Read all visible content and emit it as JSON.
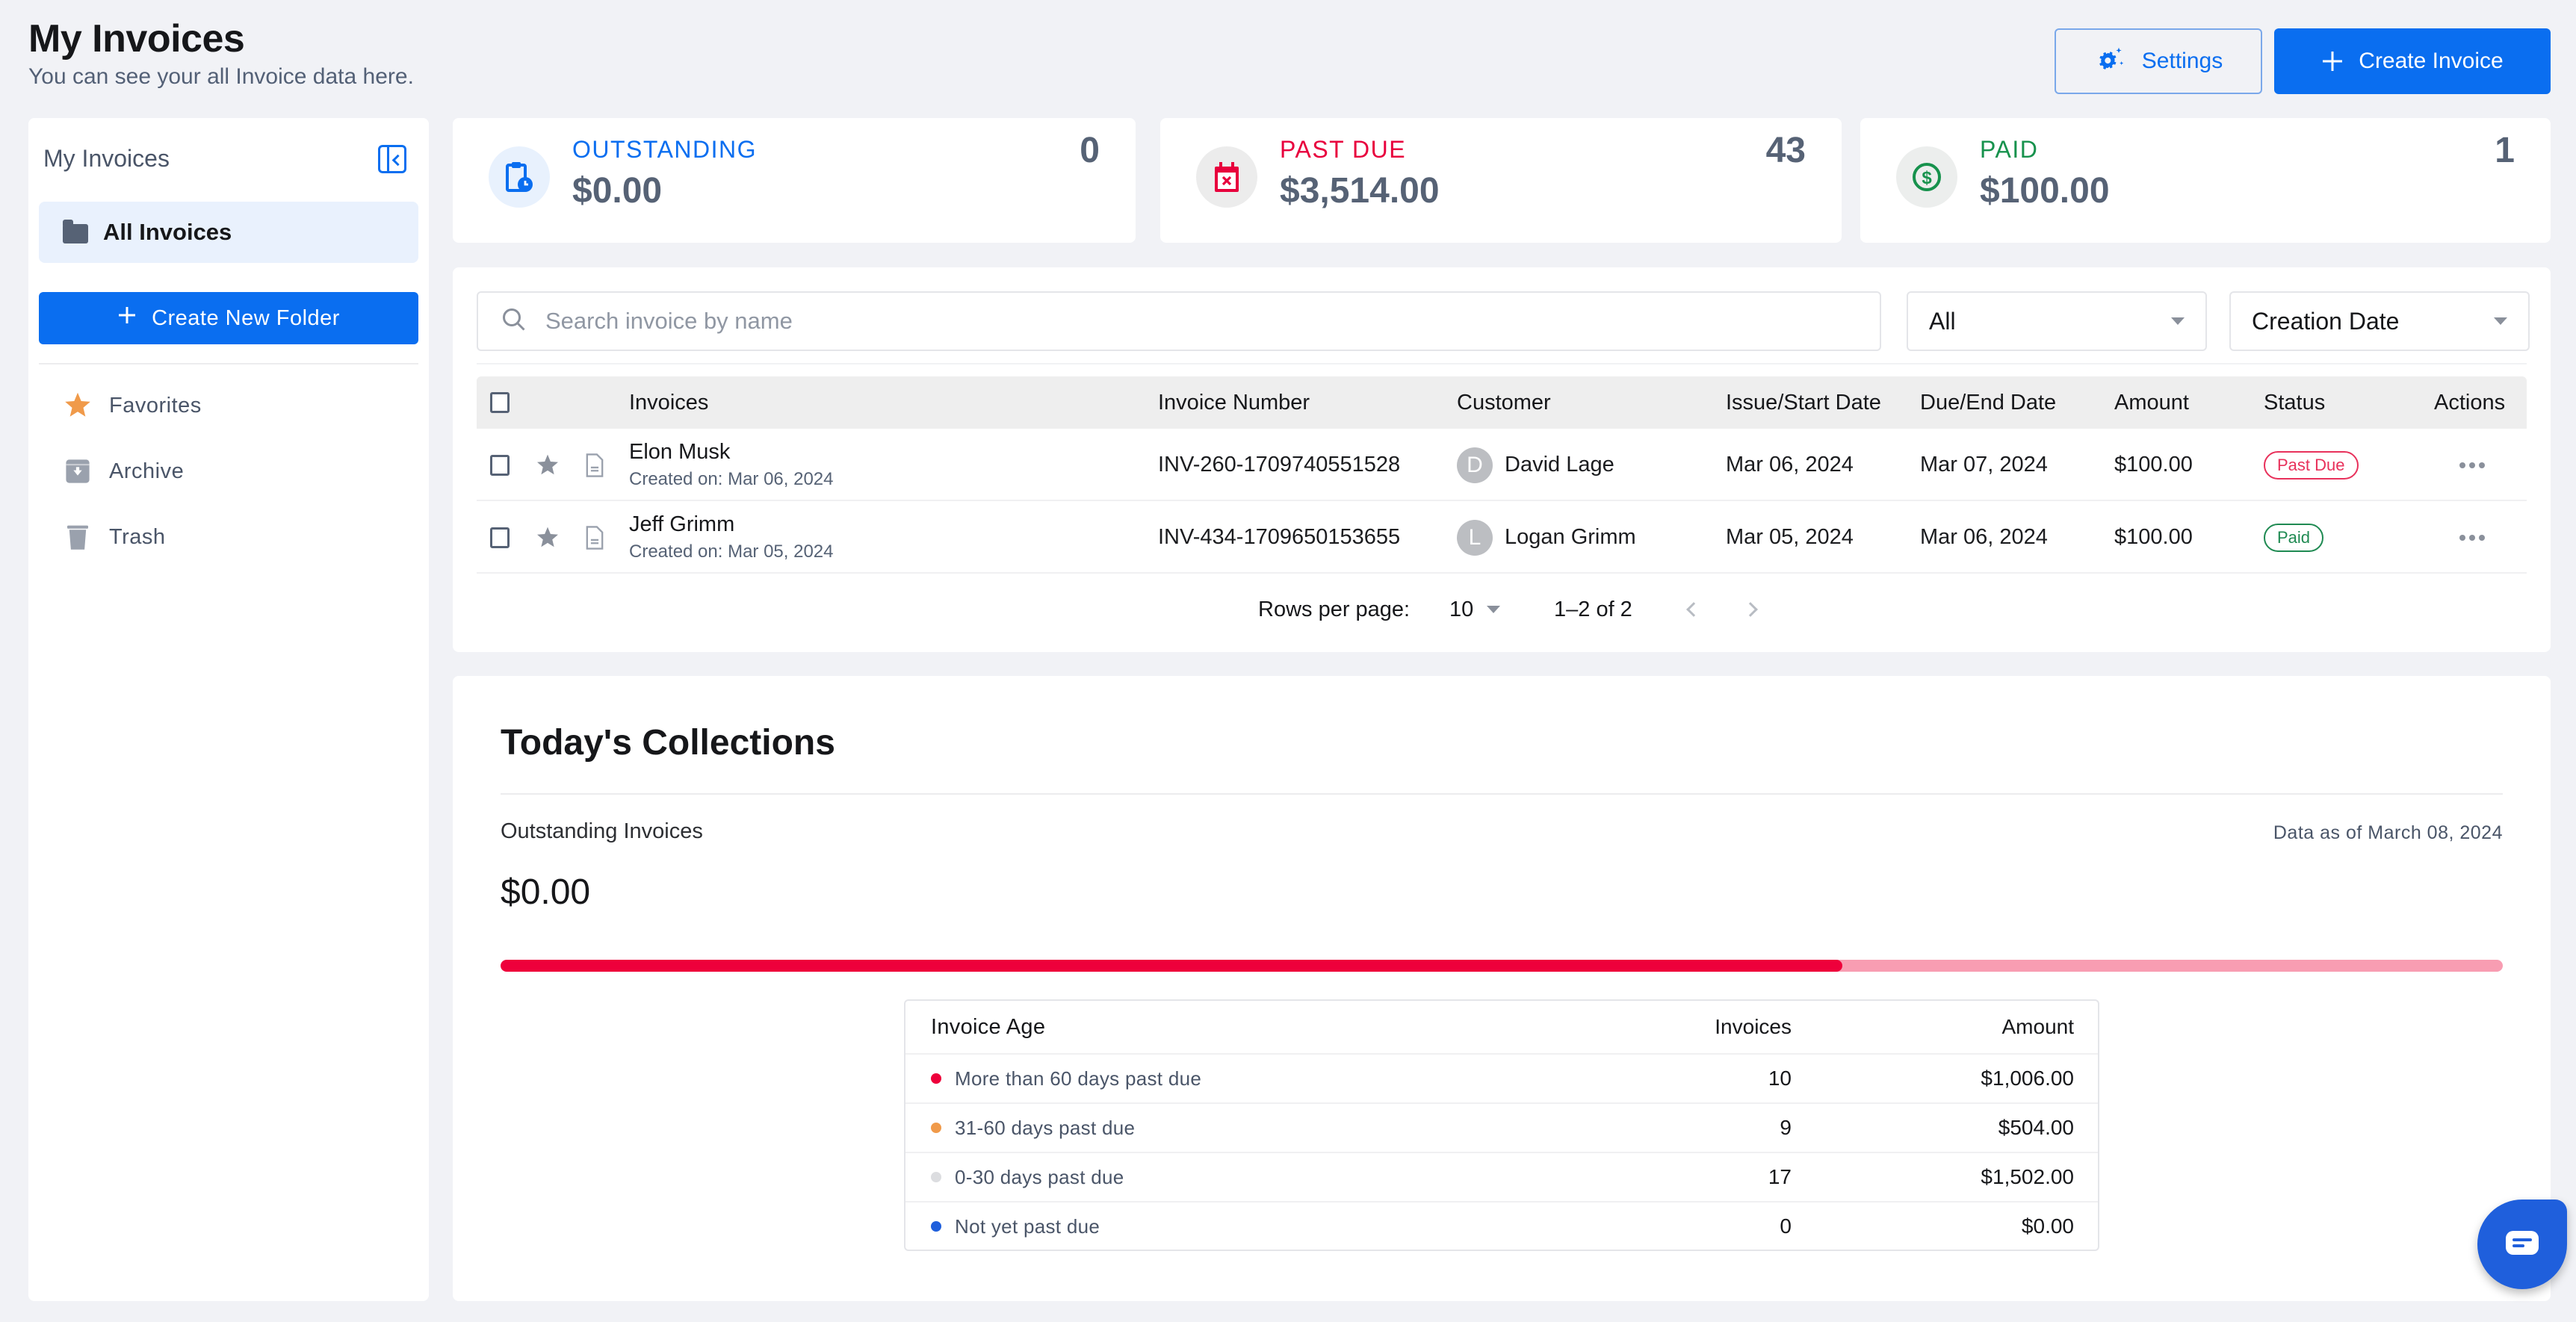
{
  "header": {
    "title": "My Invoices",
    "subtitle": "You can see your all Invoice data here.",
    "settings_label": "Settings",
    "create_invoice_label": "Create Invoice"
  },
  "sidebar": {
    "title": "My Invoices",
    "all_invoices_label": "All Invoices",
    "create_folder_label": "Create New Folder",
    "items": [
      {
        "label": "Favorites",
        "icon": "star-icon"
      },
      {
        "label": "Archive",
        "icon": "archive-icon"
      },
      {
        "label": "Trash",
        "icon": "trash-icon"
      }
    ]
  },
  "stats": [
    {
      "label": "OUTSTANDING",
      "amount": "$0.00",
      "count": "0",
      "color": "#0a6ef0",
      "icon": "clipboard-clock-icon"
    },
    {
      "label": "PAST DUE",
      "amount": "$3,514.00",
      "count": "43",
      "color": "#e8003d",
      "icon": "calendar-x-icon"
    },
    {
      "label": "PAID",
      "amount": "$100.00",
      "count": "1",
      "color": "#17924d",
      "icon": "dollar-circle-icon"
    }
  ],
  "filters": {
    "search_placeholder": "Search invoice by name",
    "search_value": "",
    "status_filter": "All",
    "sort_by": "Creation Date"
  },
  "table": {
    "columns": [
      "Invoices",
      "Invoice Number",
      "Customer",
      "Issue/Start Date",
      "Due/End Date",
      "Amount",
      "Status",
      "Actions"
    ],
    "rows": [
      {
        "name": "Elon Musk",
        "created": "Created on: Mar 06, 2024",
        "number": "INV-260-1709740551528",
        "customer_initial": "D",
        "customer": "David Lage",
        "issue_date": "Mar 06, 2024",
        "due_date": "Mar 07, 2024",
        "amount": "$100.00",
        "status": "Past Due",
        "status_color": "#e8315b"
      },
      {
        "name": "Jeff Grimm",
        "created": "Created on: Mar 05, 2024",
        "number": "INV-434-1709650153655",
        "customer_initial": "L",
        "customer": "Logan Grimm",
        "issue_date": "Mar 05, 2024",
        "due_date": "Mar 06, 2024",
        "amount": "$100.00",
        "status": "Paid",
        "status_color": "#1f8a52"
      }
    ],
    "pagination": {
      "rows_per_page_label": "Rows per page:",
      "rows_per_page": "10",
      "range": "1–2 of 2"
    }
  },
  "collections": {
    "title": "Today's Collections",
    "subtitle": "Outstanding Invoices",
    "as_of": "Data as of March 08, 2024",
    "amount": "$0.00",
    "progress_fraction": 0.67,
    "age_table": {
      "headers": [
        "Invoice Age",
        "Invoices",
        "Amount"
      ],
      "rows": [
        {
          "label": "More than 60 days past due",
          "invoices": "10",
          "amount": "$1,006.00",
          "color": "#ee003b"
        },
        {
          "label": "31-60 days past due",
          "invoices": "9",
          "amount": "$504.00",
          "color": "#f09a4a"
        },
        {
          "label": "0-30 days past due",
          "invoices": "17",
          "amount": "$1,502.00",
          "color": "#dcdde0"
        },
        {
          "label": "Not yet past due",
          "invoices": "0",
          "amount": "$0.00",
          "color": "#1f5fdc"
        }
      ]
    }
  }
}
